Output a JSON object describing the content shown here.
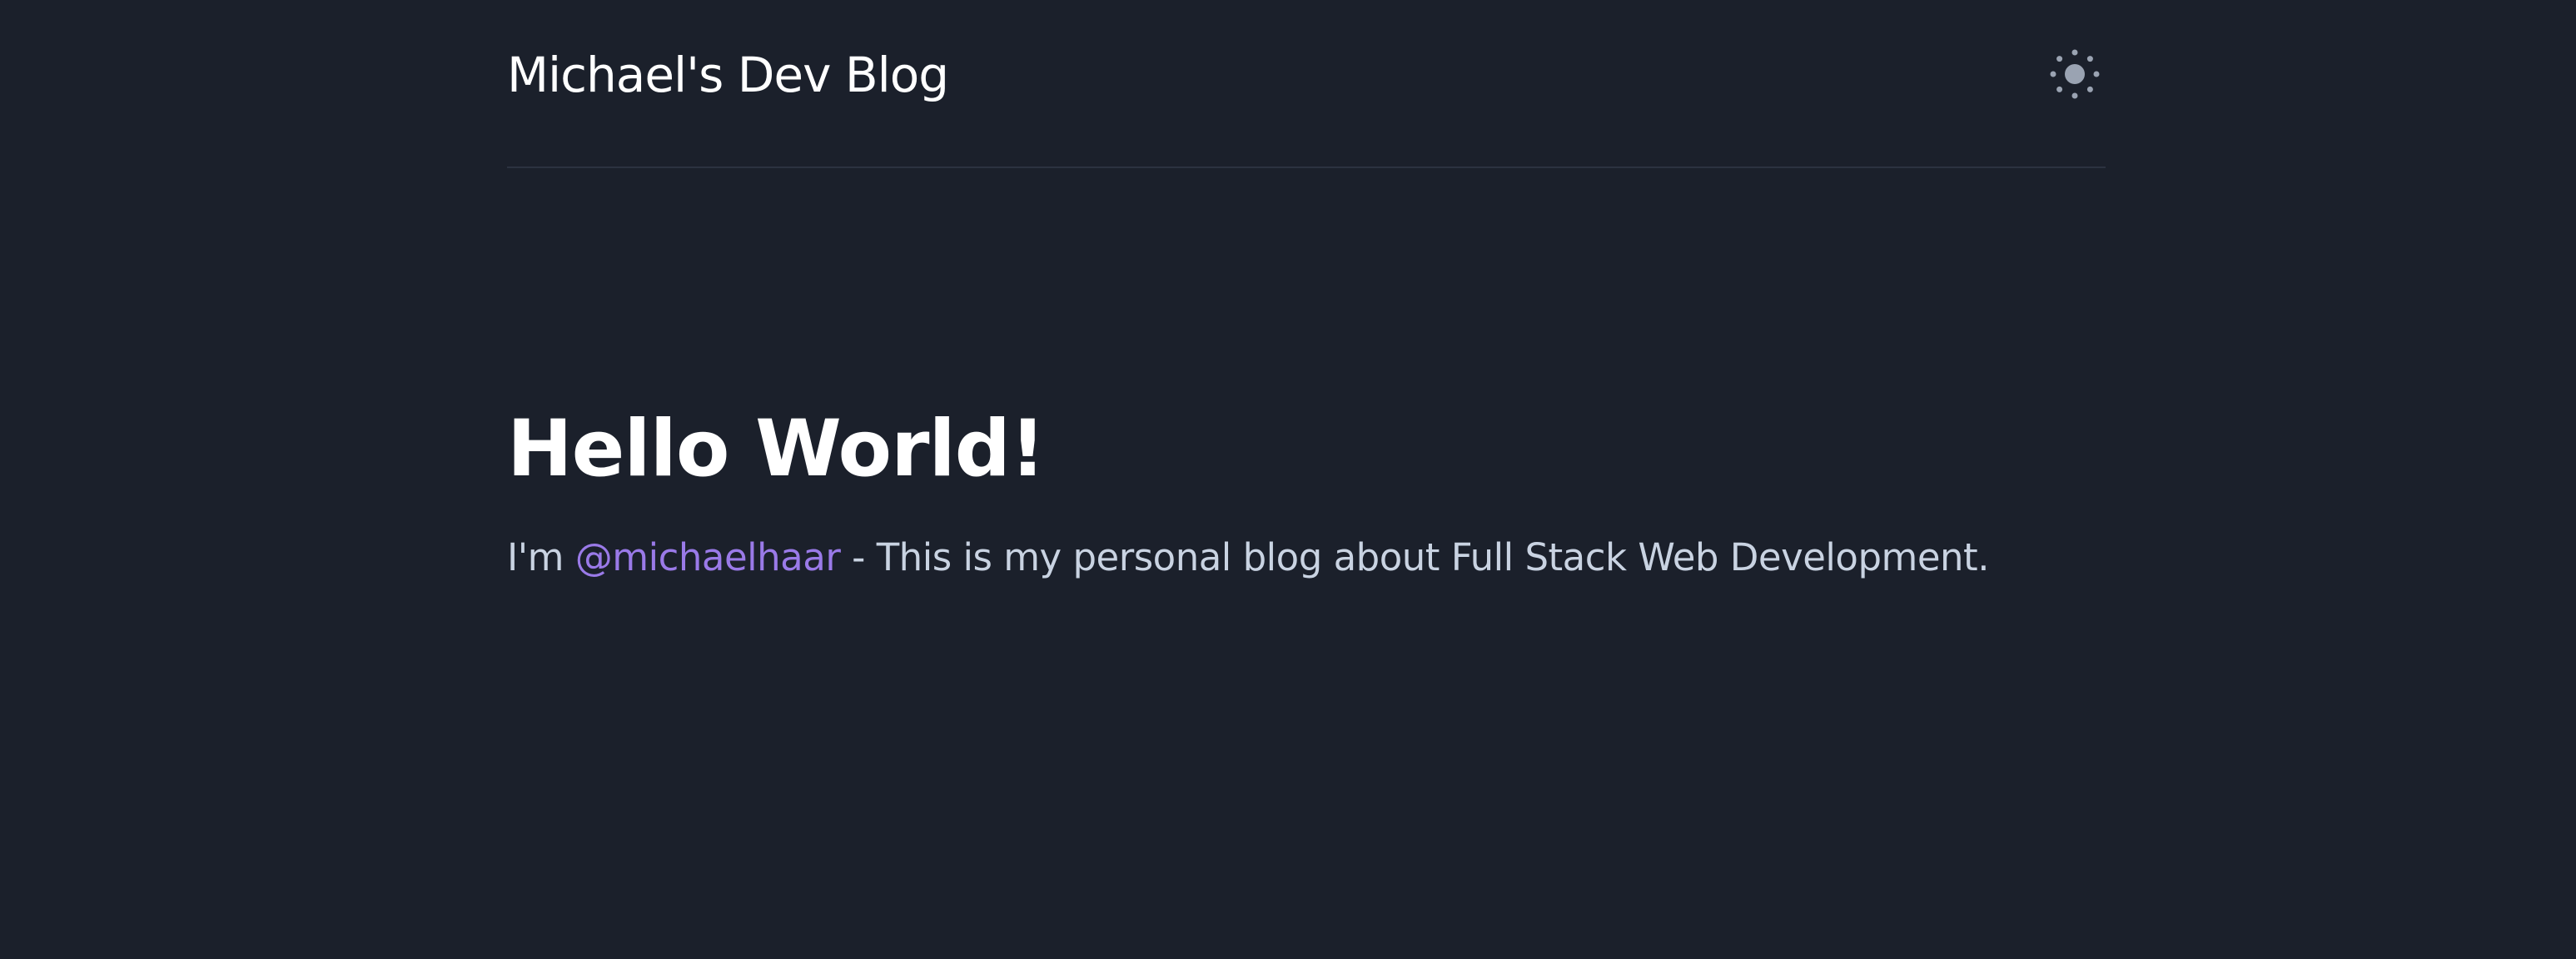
{
  "header": {
    "site_title": "Michael's Dev Blog",
    "theme_toggle_icon": "sun-icon"
  },
  "intro": {
    "headline": "Hello World!",
    "bio_prefix": "I'm ",
    "handle": "@michaelhaar",
    "bio_suffix": " - This is my personal blog about Full Stack Web Development."
  },
  "colors": {
    "background": "#1b202b",
    "link": "#9a7ae8",
    "body_text": "#c9d3e2",
    "heading_text": "#ffffff",
    "icon": "#9aa3b2"
  }
}
